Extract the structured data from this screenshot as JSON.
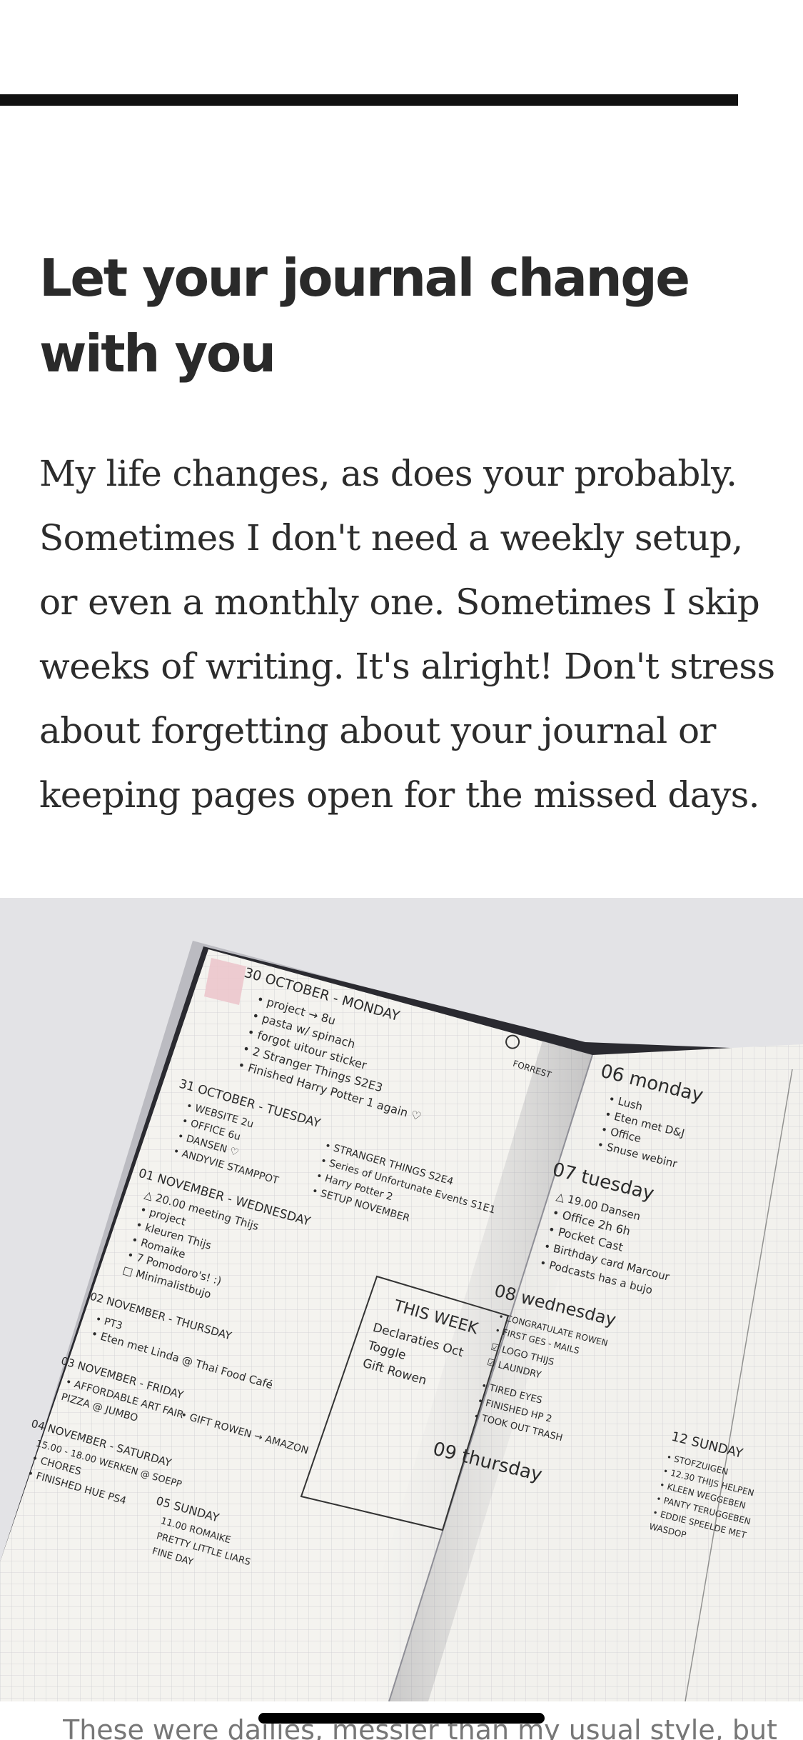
{
  "article": {
    "heading": "Let your journal change with you",
    "body": "My life changes, as does your probably. Sometimes I don't need a weekly setup, or even a monthly one. Sometimes I skip weeks of writing. It's alright! Don't stress about forgetting about your journal or keeping pages open for the missed days.",
    "caption": "These were dailies, messier than my usual style, but"
  },
  "photo": {
    "alt": "Open bullet journal with handwritten daily logs",
    "left_page_lines": [
      "30 OCTOBER - MONDAY",
      "• project → 8u",
      "• pasta w/ spinach",
      "• forgot uitour sticker",
      "• 2 Stranger Things S2E3",
      "• Finished Harry Potter 1 again ♡",
      "31 OCTOBER - TUESDAY",
      "• WEBSITE 2u",
      "• OFFICE 6u",
      "• DANSEN ♡",
      "• ANDYVIE STAMPPOT",
      "• STRANGER THINGS S2E4",
      "• Series of Unfortunate Events S1E1",
      "• Harry Potter 2",
      "• SETUP NOVEMBER",
      "01 NOVEMBER - WEDNESDAY",
      "△ 20.00 meeting Thijs",
      "• project",
      "• kleuren Thijs",
      "• Romaike",
      "• 7 Pomodoro's! :)",
      "□ Minimalistbujo",
      "02 NOVEMBER - THURSDAY",
      "• PT3",
      "• Eten met Linda @ Thai Food Café",
      "03 NOVEMBER - FRIDAY",
      "• AFFORDABLE ART FAIR",
      "• GIFT ROWEN → AMAZON",
      "PIZZA @ JUMBO",
      "04 NOVEMBER - SATURDAY",
      "15.00 - 18.00 WERKEN @ SOEPP",
      "• CHORES",
      "• FINISHED HUE PS4",
      "05 SUNDAY",
      "11.00 ROMAIKE",
      "PRETTY LITTLE LIARS",
      "FINE DAY"
    ],
    "this_week": {
      "title": "THIS WEEK",
      "items": [
        "Declaraties Oct",
        "Toggle",
        "Gift Rowen"
      ]
    },
    "forrest_label": "FORREST",
    "right_page_lines": [
      "06 monday",
      "• Lush",
      "• Eten met D&J",
      "• Office",
      "• Snuse webinr",
      "07 tuesday",
      "△ 19.00 Dansen",
      "• Office 2h 6h",
      "• Pocket Cast",
      "• Birthday card Marcour",
      "• Podcasts has a bujo",
      "08 wednesday",
      "• CONGRATULATE ROWEN",
      "• FIRST GES - MAILS",
      "☑ LOGO THIJS",
      "☑ LAUNDRY",
      "• TIRED EYES",
      "• FINISHED HP 2",
      "• TOOK OUT TRASH",
      "09 thursday",
      "12 SUNDAY",
      "• STOFZUIGEN",
      "• 12.30 THIJS HELPEN",
      "• KLEEN WEGGEBEN",
      "• PANTY TERUGGEBEN",
      "• EDDIE SPEELDE MET",
      "WASDOP"
    ]
  }
}
